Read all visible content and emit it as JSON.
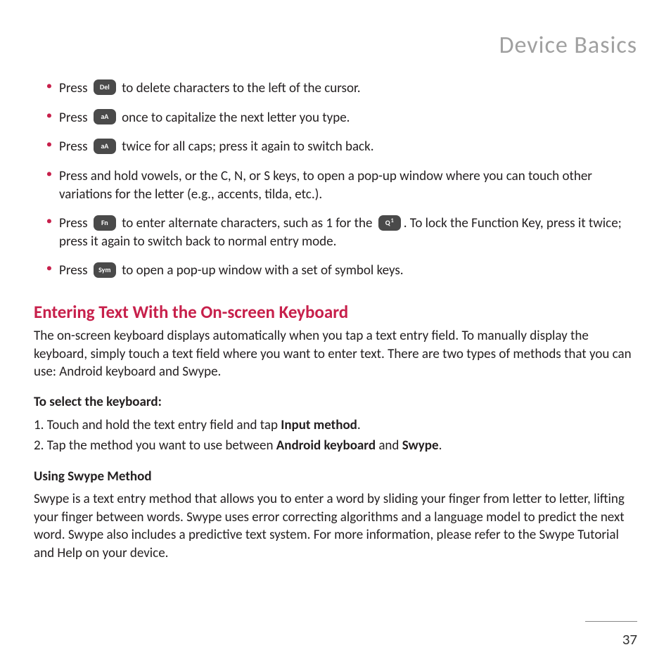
{
  "header": {
    "title": "Device Basics"
  },
  "bullets": [
    {
      "pre": "Press ",
      "key": "Del",
      "post": " to delete characters to the left of the cursor."
    },
    {
      "pre": "Press ",
      "key": "aA",
      "post": " once to capitalize the next letter you type."
    },
    {
      "pre": "Press ",
      "key": "aA",
      "post": " twice for all caps; press it again to switch back."
    },
    {
      "full": "Press and hold vowels, or the C, N, or S keys, to open a pop-up window where you can touch other variations for the letter (e.g., accents, tilda, etc.)."
    },
    {
      "pre": "Press ",
      "key": "Fn",
      "mid": " to enter alternate characters, such as 1 for the ",
      "key2q": "Q",
      "key2one": "1",
      "post": ". To lock the Function Key, press it twice; press it again to switch back to normal entry mode."
    },
    {
      "pre": "Press ",
      "key": "Sym",
      "post": " to open a pop-up window with a set of symbol keys."
    }
  ],
  "section": {
    "heading": "Entering Text With the On-screen Keyboard",
    "intro": "The on-screen keyboard displays automatically when you tap a text entry field. To manually display the keyboard, simply touch a text field where you want to enter text. There are two types of methods that you can use: Android keyboard and Swype.",
    "select_heading": "To select the keyboard:",
    "steps": [
      {
        "num": "1.",
        "pre": " Touch and hold the text entry field and tap ",
        "bold": "Input method",
        "post": "."
      },
      {
        "num": "2.",
        "pre": " Tap the method you want to use between ",
        "bold1": "Android keyboard",
        "mid": " and ",
        "bold2": "Swype",
        "post": "."
      }
    ],
    "swype_heading": "Using Swype Method",
    "swype_body": "Swype is a text entry method that allows you to enter a word by sliding your finger from letter to letter, lifting your finger between words. Swype uses error correcting algorithms and a language model to predict the next word. Swype also includes a predictive text system. For more information, please refer to the Swype Tutorial and Help on your device."
  },
  "page_number": "37"
}
